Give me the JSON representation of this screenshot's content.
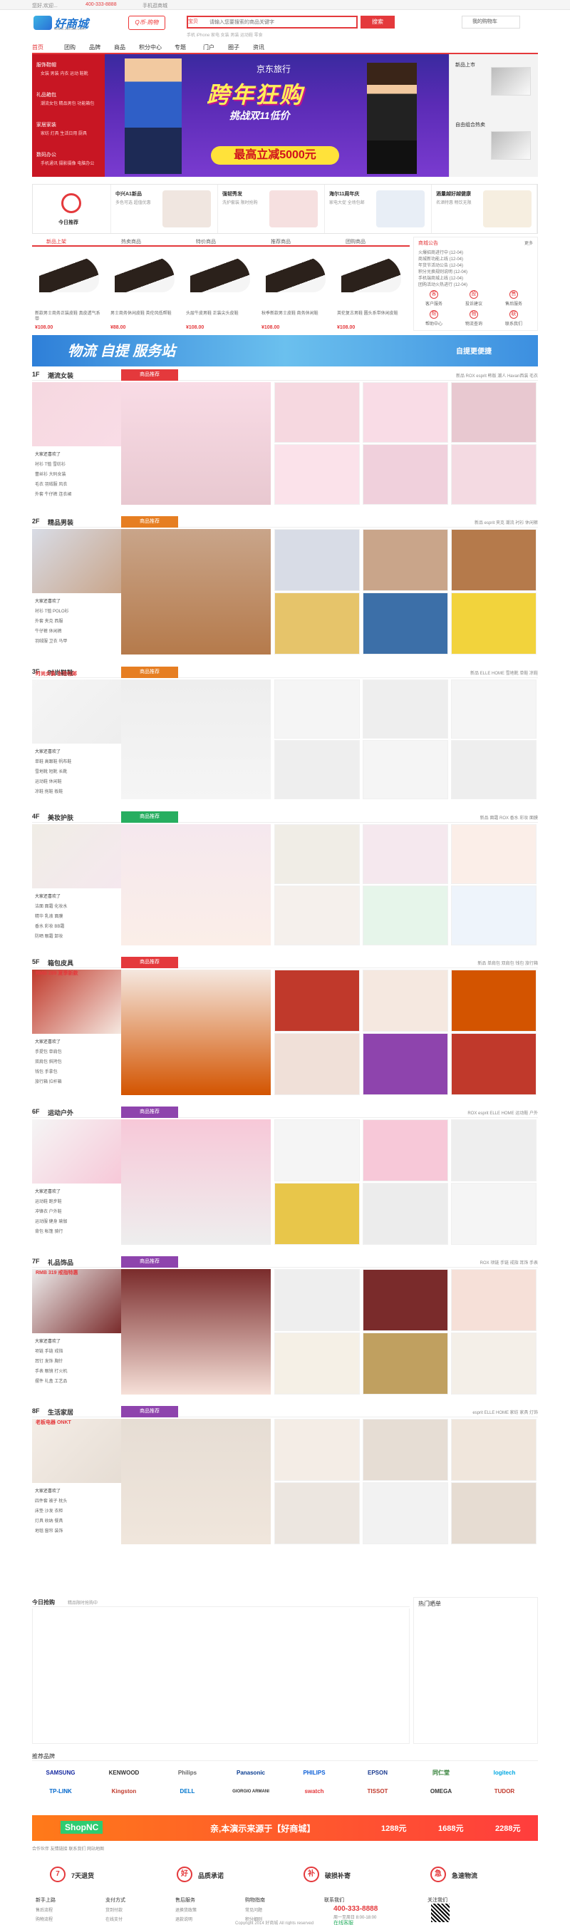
{
  "topbar": {
    "greeting": "您好,欢迎...",
    "phone": "400-333-8888",
    "mobile": "手机逛商城"
  },
  "header": {
    "logo": "好商城",
    "logo_sub": "www.33hao.com",
    "badge": "Q币·购物",
    "search_select": "宝贝",
    "search_placeholder": "请输入您要搜索的商品关键字",
    "search_button": "搜索",
    "hotwords": "手机 iPhone 家电 女装 男装 运动鞋 零食",
    "cart": "我的购物车"
  },
  "nav": [
    "首页",
    "团购",
    "品牌",
    "商品",
    "积分中心",
    "专题",
    "门户",
    "圈子",
    "资讯"
  ],
  "sidebar": [
    {
      "label": "服饰鞋帽",
      "sub": "女装 男装 内衣 运动 鞋靴"
    },
    {
      "label": "礼品箱包",
      "sub": "潮流女包 精品男包 功能箱包"
    },
    {
      "label": "家居家装",
      "sub": "家纺 灯具 生活日用 厨具"
    },
    {
      "label": "数码办公",
      "sub": "手机通讯 摄影摄像 电脑办公"
    }
  ],
  "banner": {
    "brand": "京东旅行",
    "title": "跨年狂购",
    "sub": "挑战双11低价",
    "offer": "最高立减5000元"
  },
  "right_ad": {
    "title1": "新品上市",
    "title2": "自由组合热卖"
  },
  "strip": [
    {
      "title": "今日推荐",
      "sub": ""
    },
    {
      "title": "中兴A1新品",
      "sub": "多色可选 超值优惠"
    },
    {
      "title": "强韧秀发",
      "sub": "洗护套装 限时抢购"
    },
    {
      "title": "海尔11周年庆",
      "sub": "家电大促 全场包邮"
    },
    {
      "title": "酒量越好越健康",
      "sub": "名酒特惠 畅饮无限"
    }
  ],
  "tabs": [
    "新品上架",
    "热卖商品",
    "特价商品",
    "推荐商品",
    "团购商品"
  ],
  "products": [
    {
      "name": "新款男士商务正装皮鞋 真皮透气系带",
      "price": "¥108.00"
    },
    {
      "name": "男士商务休闲皮鞋 英伦风低帮鞋",
      "price": "¥88.00"
    },
    {
      "name": "头层牛皮男鞋 正装尖头皮鞋",
      "price": "¥108.00"
    },
    {
      "name": "秋季新款男士皮鞋 商务休闲鞋",
      "price": "¥108.00"
    },
    {
      "name": "英伦复古男鞋 圆头系带休闲皮鞋",
      "price": "¥108.00"
    }
  ],
  "news": {
    "title": "商城公告",
    "more": "更多",
    "items": [
      "火爆招商进行中 (12-04)",
      "商城新功能上线 (12-04)",
      "年货节活动公告 (12-04)",
      "积分兑换规则说明 (12-04)",
      "手机端商城上线 (12-04)",
      "团购活动火热进行 (12-04)"
    ],
    "services": [
      "客户服务",
      "投诉建议",
      "售后服务",
      "帮助中心",
      "物流查询",
      "联系我们"
    ]
  },
  "ad": {
    "title": "物流 自提 服务站",
    "right": "自提更便捷"
  },
  "floors": [
    {
      "num": "1F",
      "name": "潮流女装",
      "tag": "商品推荐",
      "color": "#e4393c",
      "links": "新品 ROX esprit 韩版 潮人 Havan西装 毛衣",
      "side": [
        "大家还喜欢了",
        "衬衫 T恤 雪纺衫",
        "蕾丝衫 大码女装",
        "毛衣 羽绒服 风衣",
        "外套 牛仔裤 连衣裙"
      ]
    },
    {
      "num": "2F",
      "name": "精品男装",
      "tag": "商品推荐",
      "color": "#e67e22",
      "links": "新品 esprit 夹克 潮流 衬衫 休闲裤",
      "side": [
        "大家还喜欢了",
        "衬衫 T恤 POLO衫",
        "外套 夹克 西服",
        "牛仔裤 休闲裤",
        "羽绒服 卫衣 马甲"
      ]
    },
    {
      "num": "3F",
      "name": "时尚鞋靴",
      "tag": "商品推荐",
      "color": "#e67e22",
      "links": "新品 ELLE HOME 雪地靴 单鞋 凉鞋",
      "side": [
        "大家还喜欢了",
        "单鞋 高跟鞋 帆布鞋",
        "雪地靴 短靴 长靴",
        "运动鞋 休闲鞋",
        "凉鞋 拖鞋 板鞋"
      ]
    },
    {
      "num": "4F",
      "name": "美妆护肤",
      "tag": "商品推荐",
      "color": "#27ae60",
      "links": "新品 面霜 ROX 香水 彩妆 面膜",
      "side": [
        "大家还喜欢了",
        "洁面 面霜 化妆水",
        "精华 乳液 面膜",
        "香水 彩妆 BB霜",
        "防晒 眼霜 卸妆"
      ]
    },
    {
      "num": "5F",
      "name": "箱包皮具",
      "tag": "商品推荐",
      "color": "#e4393c",
      "links": "新品 单肩包 双肩包 钱包 旅行箱",
      "side": [
        "大家还喜欢了",
        "手提包 单肩包",
        "双肩包 斜挎包",
        "钱包 手拿包",
        "旅行箱 拉杆箱"
      ]
    },
    {
      "num": "6F",
      "name": "运动户外",
      "tag": "商品推荐",
      "color": "#8e44ad",
      "links": "ROX esprit ELLE HOME 运动鞋 户外",
      "side": [
        "大家还喜欢了",
        "运动鞋 跑步鞋",
        "冲锋衣 户外鞋",
        "运动服 健身 瑜伽",
        "背包 帐篷 骑行"
      ]
    },
    {
      "num": "7F",
      "name": "礼品饰品",
      "tag": "商品推荐",
      "color": "#8e44ad",
      "links": "ROX 项链 手链 戒指 耳饰 手表",
      "side": [
        "大家还喜欢了",
        "项链 手链 戒指",
        "耳钉 发饰 胸针",
        "手表 眼镜 打火机",
        "摆件 礼盒 工艺品"
      ]
    },
    {
      "num": "8F",
      "name": "生活家居",
      "tag": "商品推荐",
      "color": "#8e44ad",
      "links": "esprit ELLE HOME 家纺 家具 灯饰",
      "side": [
        "大家还喜欢了",
        "四件套 被子 枕头",
        "床垫 沙发 衣柜",
        "灯具 收纳 餐具",
        "地毯 窗帘 装饰"
      ]
    }
  ],
  "floor_side_promo": [
    "时尚女装 全场包邮",
    "RMB 289 夏季新款",
    "RMB 319 戒指特惠",
    "老板电器 ONKT"
  ],
  "today": {
    "title": "今日抢购",
    "sub": "精品限时抢购中",
    "hot": "热门晒单"
  },
  "brands_title": "推荐品牌",
  "brands": [
    "SAMSUNG",
    "KENWOOD",
    "Philips",
    "Panasonic",
    "PHILIPS",
    "EPSON",
    "同仁堂",
    "logitech",
    "TP-LINK",
    "Kingston",
    "DELL",
    "GIORGIO ARMANI",
    "swatch",
    "TISSOT",
    "OMEGA",
    "TUDOR"
  ],
  "promo": {
    "left": "ShopNC",
    "text": "亲,本演示来源于【好商城】",
    "p1": "1288元",
    "p2": "1688元",
    "p3": "2288元"
  },
  "bottom_links": "合作伙伴 友情链接 联系我们 网站地图",
  "guarantees": [
    {
      "icon": "7",
      "label": "7天退货"
    },
    {
      "icon": "好",
      "label": "品质承诺"
    },
    {
      "icon": "补",
      "label": "破损补寄"
    },
    {
      "icon": "急",
      "label": "急速物流"
    }
  ],
  "footer_cols": [
    {
      "title": "新手上路",
      "items": [
        "售后流程",
        "购物流程",
        "订购方式"
      ]
    },
    {
      "title": "支付方式",
      "items": [
        "货到付款",
        "在线支付",
        "分期付款"
      ]
    },
    {
      "title": "售后服务",
      "items": [
        "退换货政策",
        "退款说明",
        "联系卖家"
      ]
    },
    {
      "title": "购物指南",
      "items": [
        "常见问题",
        "积分细则",
        "会员介绍"
      ]
    }
  ],
  "contact": {
    "title": "联系我们",
    "phone": "400-333-8888",
    "hours": "周一至周日 8:00-18:00",
    "online": "在线客服"
  },
  "follow": "关注我们",
  "copyright": "Copyright 2014 好商城 All rights reserved"
}
